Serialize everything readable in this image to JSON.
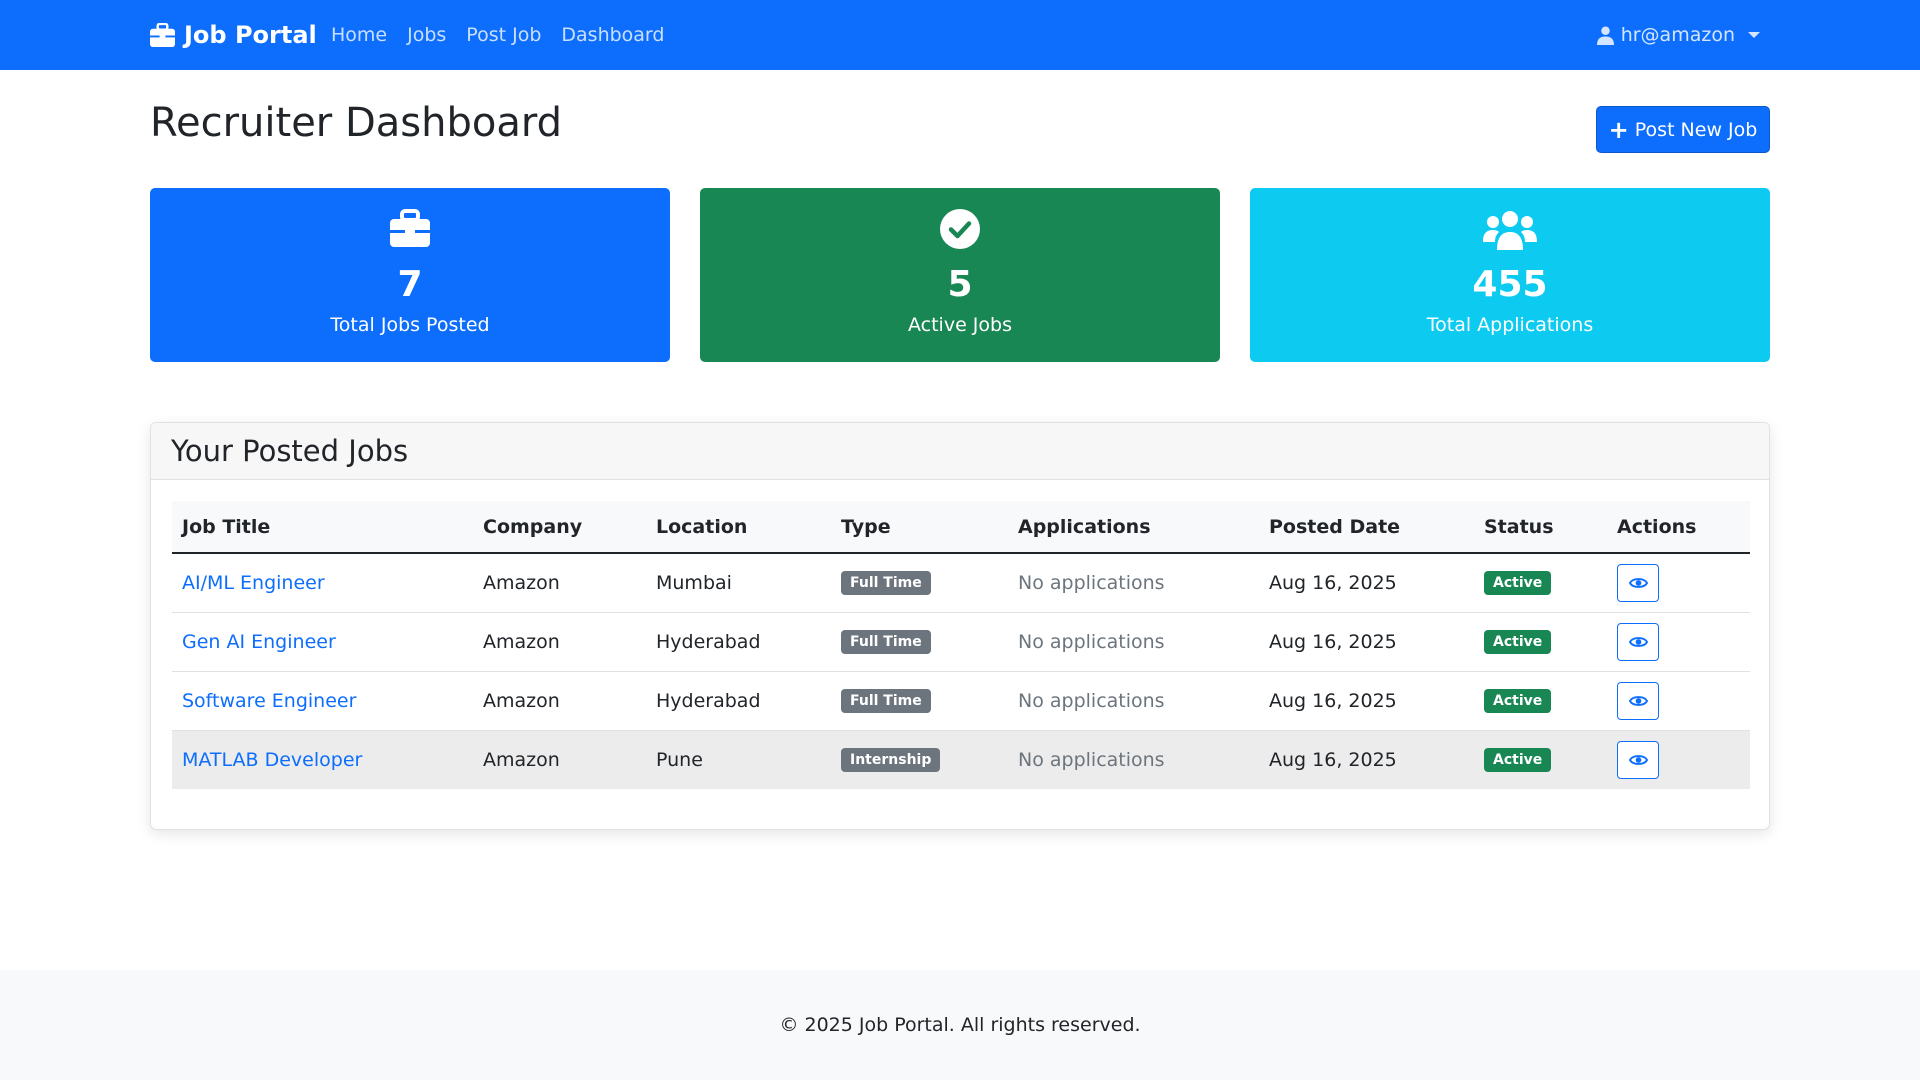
{
  "colors": {
    "primary": "#0d6efd",
    "success": "#198754",
    "info": "#0dcaf0",
    "secondary": "#6c757d"
  },
  "navbar": {
    "brand_icon": "briefcase-icon",
    "brand": "Job Portal",
    "links": [
      "Home",
      "Jobs",
      "Post Job",
      "Dashboard"
    ],
    "user_icon": "user-icon",
    "user": "hr@amazon"
  },
  "header": {
    "title": "Recruiter Dashboard",
    "post_button_label": "Post New Job",
    "post_button_icon": "plus-icon"
  },
  "stats": [
    {
      "icon": "briefcase-icon",
      "value": "7",
      "label": "Total Jobs Posted",
      "color": "#0d6efd"
    },
    {
      "icon": "check-circle-icon",
      "value": "5",
      "label": "Active Jobs",
      "color": "#198754"
    },
    {
      "icon": "users-icon",
      "value": "455",
      "label": "Total Applications",
      "color": "#0dcaf0"
    }
  ],
  "jobs": {
    "heading": "Your Posted Jobs",
    "columns": [
      "Job Title",
      "Company",
      "Location",
      "Type",
      "Applications",
      "Posted Date",
      "Status",
      "Actions"
    ],
    "rows": [
      {
        "title": "AI/ML Engineer",
        "company": "Amazon",
        "location": "Mumbai",
        "type": "Full Time",
        "applications": "No applications",
        "date": "Aug 16, 2025",
        "status": "Active",
        "action_icon": "eye-icon"
      },
      {
        "title": "Gen AI Engineer",
        "company": "Amazon",
        "location": "Hyderabad",
        "type": "Full Time",
        "applications": "No applications",
        "date": "Aug 16, 2025",
        "status": "Active",
        "action_icon": "eye-icon"
      },
      {
        "title": "Software Engineer",
        "company": "Amazon",
        "location": "Hyderabad",
        "type": "Full Time",
        "applications": "No applications",
        "date": "Aug 16, 2025",
        "status": "Active",
        "action_icon": "eye-icon"
      },
      {
        "title": "MATLAB Developer",
        "company": "Amazon",
        "location": "Pune",
        "type": "Internship",
        "applications": "No applications",
        "date": "Aug 16, 2025",
        "status": "Active",
        "action_icon": "eye-icon"
      }
    ]
  },
  "footer": {
    "text": "© 2025 Job Portal. All rights reserved."
  }
}
